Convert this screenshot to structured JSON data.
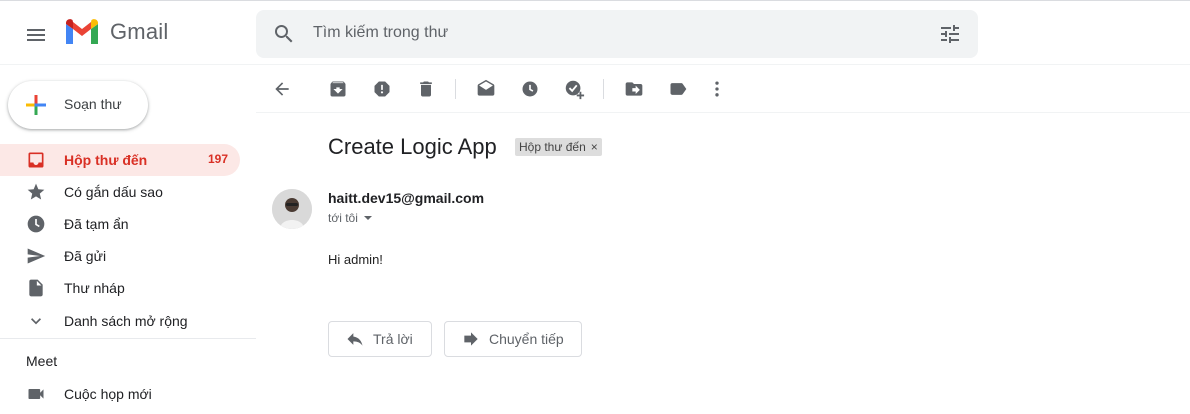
{
  "header": {
    "app_name": "Gmail",
    "search_placeholder": "Tìm kiếm trong thư"
  },
  "sidebar": {
    "compose_label": "Soạn thư",
    "items": [
      {
        "label": "Hộp thư đến",
        "count": "197",
        "icon": "inbox-icon",
        "active": true
      },
      {
        "label": "Có gắn dấu sao",
        "icon": "star-icon"
      },
      {
        "label": "Đã tạm ẩn",
        "icon": "clock-icon"
      },
      {
        "label": "Đã gửi",
        "icon": "send-icon"
      },
      {
        "label": "Thư nháp",
        "icon": "draft-icon"
      },
      {
        "label": "Danh sách mở rộng",
        "icon": "chevron-down-icon"
      }
    ],
    "meet": {
      "heading": "Meet",
      "items": [
        {
          "label": "Cuộc họp mới",
          "icon": "videocam-icon"
        }
      ]
    }
  },
  "toolbar": {
    "icons": [
      "back-arrow-icon",
      "archive-icon",
      "report-spam-icon",
      "delete-icon",
      "mark-unread-icon",
      "snooze-icon",
      "add-task-icon",
      "move-to-icon",
      "label-icon",
      "more-vert-icon"
    ]
  },
  "message": {
    "subject": "Create Logic App",
    "label_chip": "Hộp thư đến",
    "label_chip_close": "×",
    "sender": "haitt.dev15@gmail.com",
    "to": "tới tôi",
    "body": "Hi admin!",
    "reply_label": "Trả lời",
    "forward_label": "Chuyển tiếp"
  },
  "colors": {
    "accent_red": "#d93025",
    "active_bg": "#fce8e6",
    "search_bg": "#f1f3f4",
    "icon_gray": "#5f6368"
  }
}
